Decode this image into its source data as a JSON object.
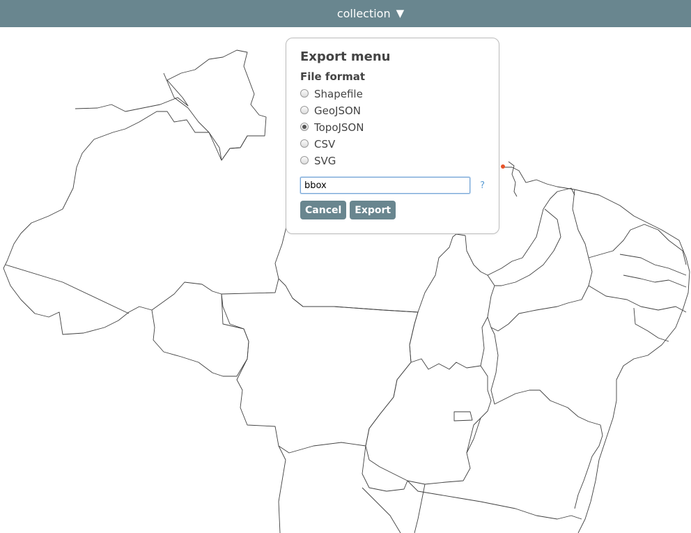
{
  "topbar": {
    "collection_label": "collection",
    "caret": "▼",
    "background": "#69868f"
  },
  "export_menu": {
    "title": "Export menu",
    "file_format_label": "File format",
    "formats": [
      "Shapefile",
      "GeoJSON",
      "TopoJSON",
      "CSV",
      "SVG"
    ],
    "selected_format": "TopoJSON",
    "options_input_value": "bbox",
    "help_icon": "?",
    "cancel_label": "Cancel",
    "export_label": "Export",
    "button_color": "#69868f"
  },
  "map": {
    "stroke_color": "#3f3f3f",
    "marker_color": "#e8542a"
  }
}
